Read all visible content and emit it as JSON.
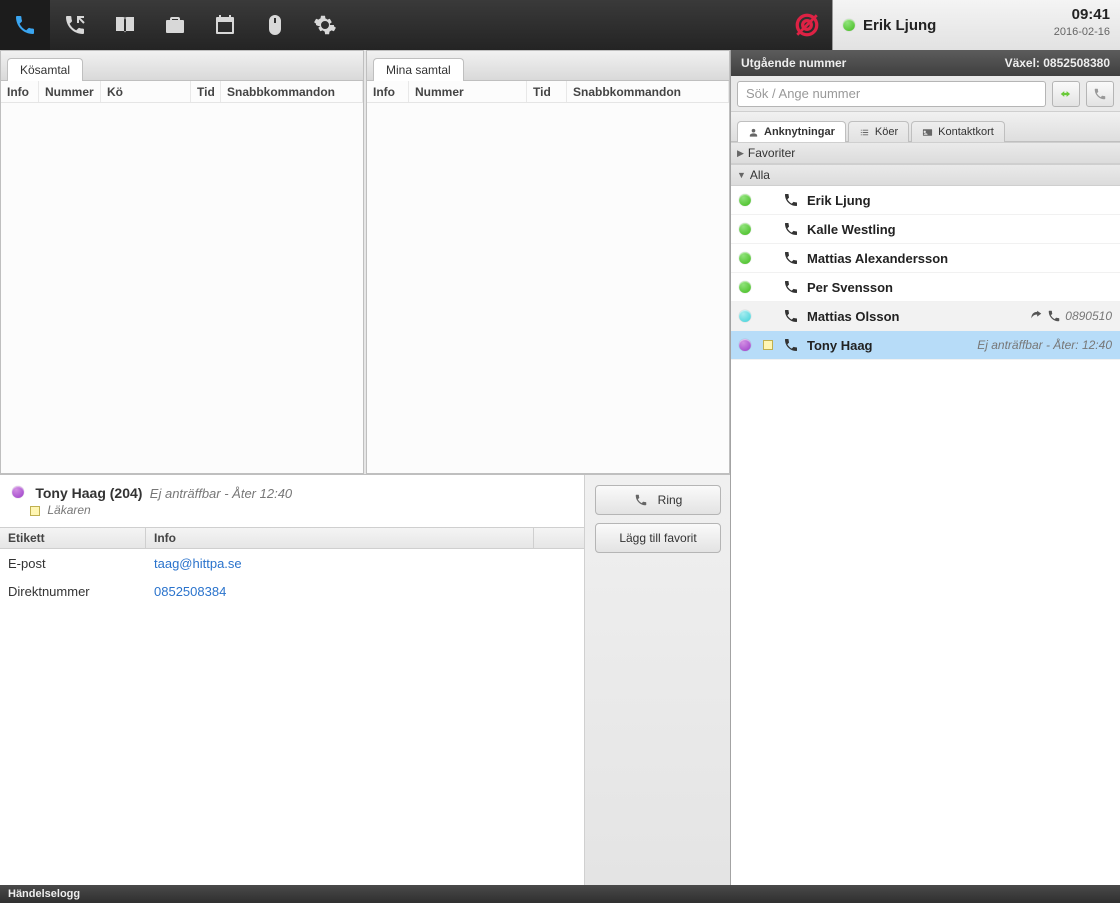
{
  "topbar": {
    "icons": [
      "phone-icon",
      "phone-arrow-icon",
      "book-icon",
      "briefcase-icon",
      "calendar-icon",
      "mouse-icon",
      "gears-icon"
    ],
    "user_name": "Erik Ljung",
    "time": "09:41",
    "date": "2016-02-16"
  },
  "panels": {
    "left": {
      "tab": "Kösamtal",
      "cols": [
        "Info",
        "Nummer",
        "Kö",
        "Tid",
        "Snabbkommandon"
      ]
    },
    "right": {
      "tab": "Mina samtal",
      "cols": [
        "Info",
        "Nummer",
        "Tid",
        "Snabbkommandon"
      ]
    }
  },
  "contact": {
    "name": "Tony Haag (204)",
    "status": "Ej anträffbar - Åter 12:40",
    "subtitle": "Läkaren",
    "cols": {
      "etikett": "Etikett",
      "info": "Info"
    },
    "rows": [
      {
        "label": "E-post",
        "value": "taag@hittpa.se"
      },
      {
        "label": "Direktnummer",
        "value": "0852508384"
      }
    ],
    "buttons": {
      "ring": "Ring",
      "fav": "Lägg till favorit"
    }
  },
  "right": {
    "bar_left": "Utgående nummer",
    "bar_right": "Växel: 0852508380",
    "search_placeholder": "Sök / Ange nummer",
    "tabs": {
      "ext": "Anknytningar",
      "koer": "Köer",
      "kort": "Kontaktkort"
    },
    "group_fav": "Favoriter",
    "group_all": "Alla",
    "exts": [
      {
        "name": "Erik Ljung",
        "presence": "green",
        "note": false,
        "right": "",
        "rightKind": ""
      },
      {
        "name": "Kalle Westling",
        "presence": "green",
        "note": false,
        "right": "",
        "rightKind": ""
      },
      {
        "name": "Mattias Alexandersson",
        "presence": "green",
        "note": false,
        "right": "",
        "rightKind": ""
      },
      {
        "name": "Per Svensson",
        "presence": "green",
        "note": false,
        "right": "",
        "rightKind": ""
      },
      {
        "name": "Mattias Olsson",
        "presence": "teal",
        "note": false,
        "right": "0890510",
        "rightKind": "out"
      },
      {
        "name": "Tony Haag",
        "presence": "purple",
        "note": true,
        "right": "Ej anträffbar - Åter: 12:40",
        "rightKind": "status"
      }
    ]
  },
  "footer": "Händelselogg"
}
